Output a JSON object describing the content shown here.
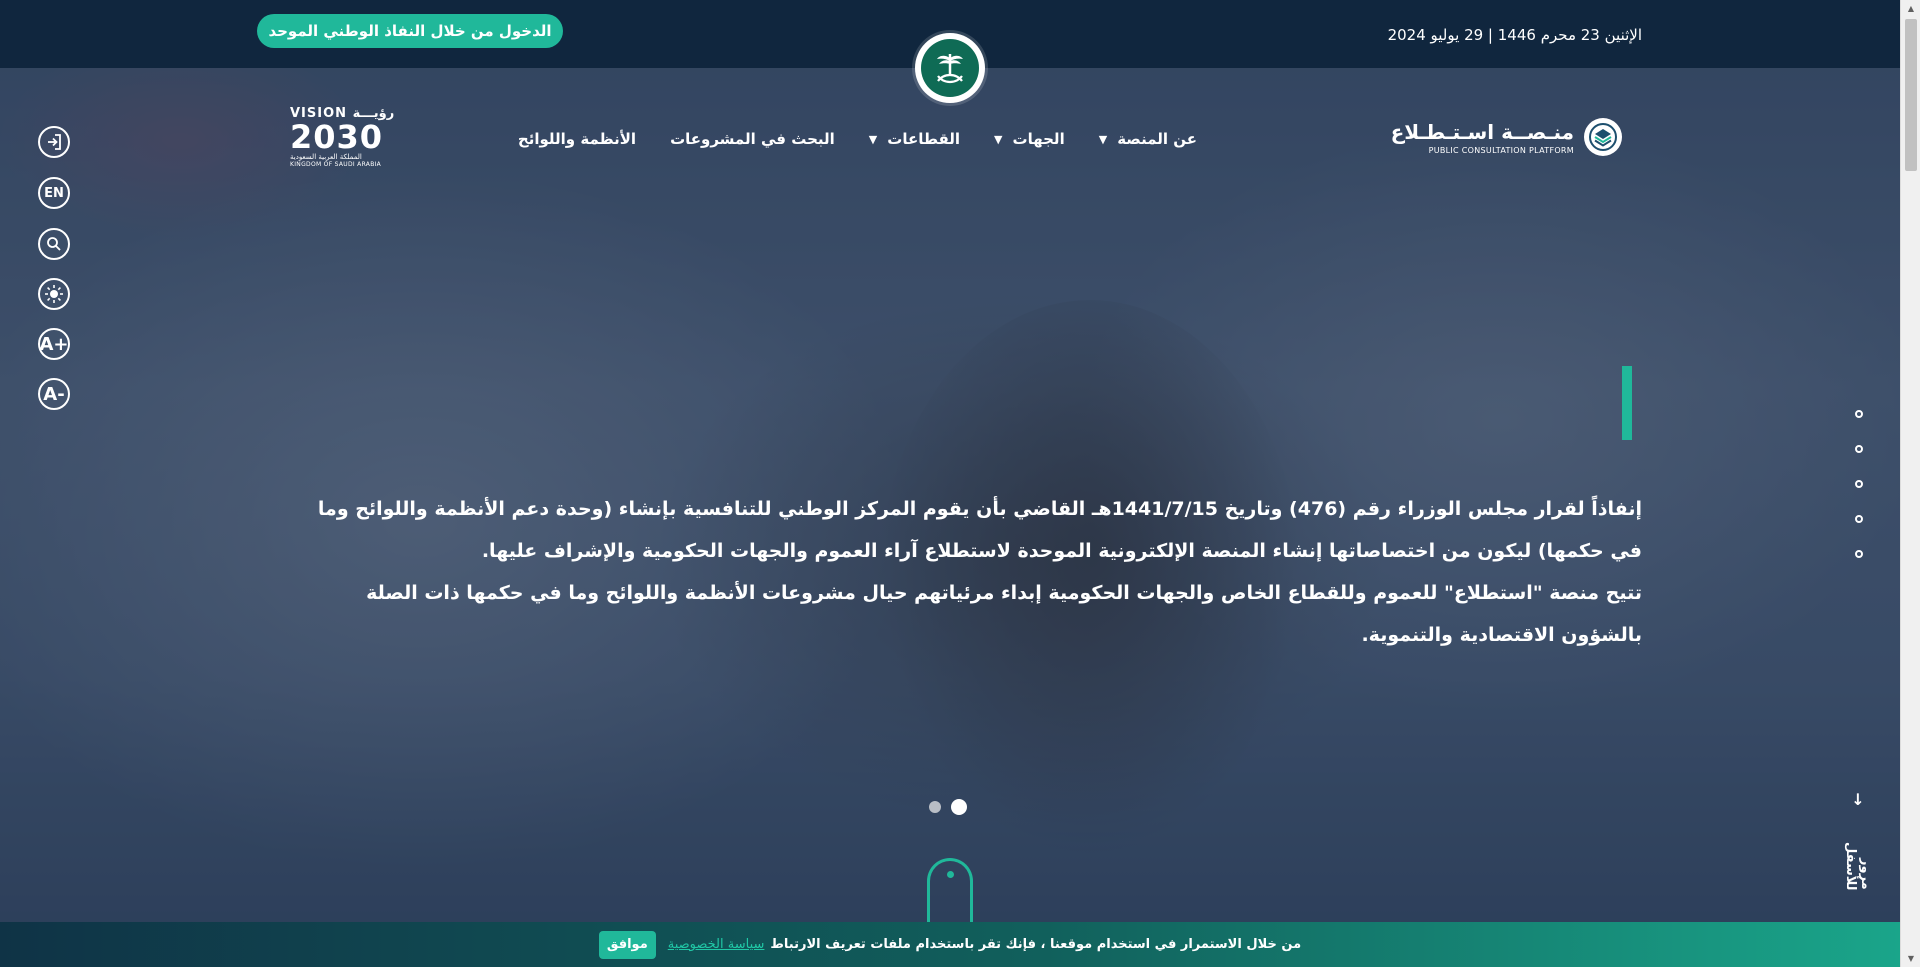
{
  "topbar": {
    "date": "الإثنين 23 محرم 1446 | 29 يوليو 2024",
    "nafath_button": "الدخول من خلال النفاذ الوطني الموحد"
  },
  "header": {
    "platform_name_ar": "منـصــة اسـتـطـلاع",
    "platform_name_en": "PUBLIC CONSULTATION PLATFORM",
    "vision_label_top": "VISION رؤيـــة",
    "vision_year": "2030",
    "vision_ksa_ar": "المملكة العربية السعودية",
    "vision_ksa_en": "KINGDOM OF SAUDI ARABIA"
  },
  "nav": {
    "items": [
      {
        "label": "عن المنصة",
        "has_dropdown": true
      },
      {
        "label": "الجهات",
        "has_dropdown": true
      },
      {
        "label": "القطاعات",
        "has_dropdown": true
      },
      {
        "label": "البحث في المشروعات",
        "has_dropdown": false
      },
      {
        "label": "الأنظمة واللوائح",
        "has_dropdown": false
      }
    ]
  },
  "utilities": {
    "login_icon": "login-icon",
    "language": "EN",
    "search_icon": "search-icon",
    "contrast_icon": "brightness-icon",
    "font_increase": "A+",
    "font_decrease": "A-"
  },
  "hero": {
    "paragraph1": "إنفاذاً لقرار مجلس الوزراء رقم (476) وتاريخ 1441/7/15هـ القاضي بأن يقوم المركز الوطني للتنافسية بإنشاء (وحدة دعم الأنظمة واللوائح وما في حكمها) ليكون من اختصاصاتها إنشاء المنصة الإلكترونية الموحدة لاستطلاع آراء العموم والجهات الحكومية والإشراف عليها.",
    "paragraph2": "تتيح منصة \"استطلاع\" للعموم وللقطاع الخاص والجهات الحكومية إبداء مرئياتهم حيال مشروعات الأنظمة واللوائح وما في حكمها ذات الصلة بالشؤون الاقتصادية والتنموية.",
    "slides_count": 2,
    "active_slide": 2,
    "side_sections_count": 5
  },
  "scroll_hint": {
    "label": "مرور للأسفل",
    "arrow": "↓"
  },
  "cookie": {
    "message": "من خلال الاستمرار في استخدام موقعنا ، فإنك تقر باستخدام ملفات تعريف الارتباط",
    "policy_link": "سياسة الخصوصية",
    "agree_button": "موافق"
  },
  "colors": {
    "topbar_bg": "#10263e",
    "accent": "#20b89a",
    "text": "#ffffff"
  }
}
